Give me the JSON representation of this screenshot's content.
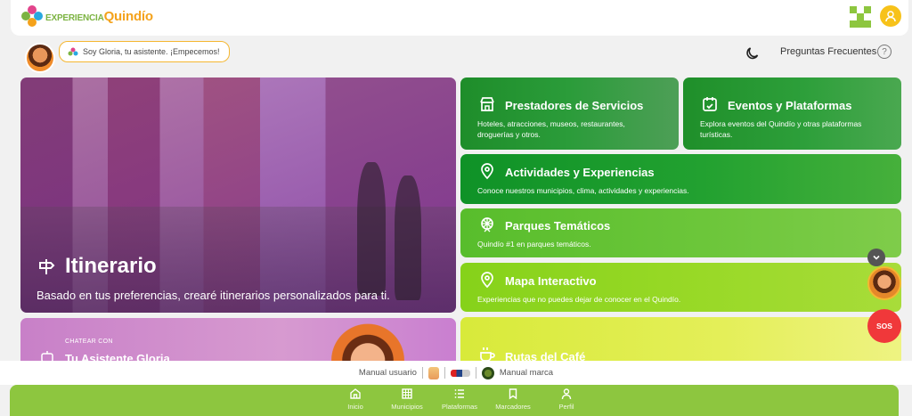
{
  "brand": {
    "logo_small": "EXPERIENCIA",
    "logo_big": "Quindío"
  },
  "assistant": {
    "greeting": "Soy Gloria, tu asistente. ¡Empecemos!"
  },
  "header": {
    "faq_label": "Preguntas Frecuentes",
    "help_symbol": "?"
  },
  "itinerario": {
    "title": "Itinerario",
    "subtitle": "Basado en tus preferencias, crearé itinerarios personalizados para ti."
  },
  "gloria_card": {
    "kicker": "CHATEAR CON",
    "title": "Tu Asistente Gloria"
  },
  "tiles": {
    "prestadores": {
      "title": "Prestadores de Servicios",
      "desc": "Hoteles, atracciones, museos, restaurantes, droguerías y otros."
    },
    "eventos": {
      "title": "Eventos y Plataformas",
      "desc": "Explora eventos del Quindío y otras plataformas turísticas."
    },
    "actividades": {
      "title": "Actividades y Experiencias",
      "desc": "Conoce nuestros municipios, clima, actividades y experiencias."
    },
    "parques": {
      "title": "Parques Temáticos",
      "desc": "Quindío #1 en parques temáticos."
    },
    "mapa": {
      "title": "Mapa Interactivo",
      "desc": "Experiencias que no puedes dejar de conocer en el Quindío."
    },
    "rutas": {
      "title": "Rutas del Café"
    }
  },
  "floating": {
    "sos_label": "SOS"
  },
  "footer": {
    "manual_usuario": "Manual usuario",
    "manual_marca": "Manual marca"
  },
  "nav": {
    "items": [
      {
        "label": "Inicio",
        "icon": "home-icon"
      },
      {
        "label": "Municipios",
        "icon": "grid-icon"
      },
      {
        "label": "Plataformas",
        "icon": "list-icon"
      },
      {
        "label": "Marcadores",
        "icon": "bookmark-icon"
      },
      {
        "label": "Perfil",
        "icon": "person-icon"
      }
    ]
  },
  "colors": {
    "brand_green": "#8dc63f",
    "accent_yellow": "#f7c21a",
    "sos_red": "#f0383a"
  }
}
